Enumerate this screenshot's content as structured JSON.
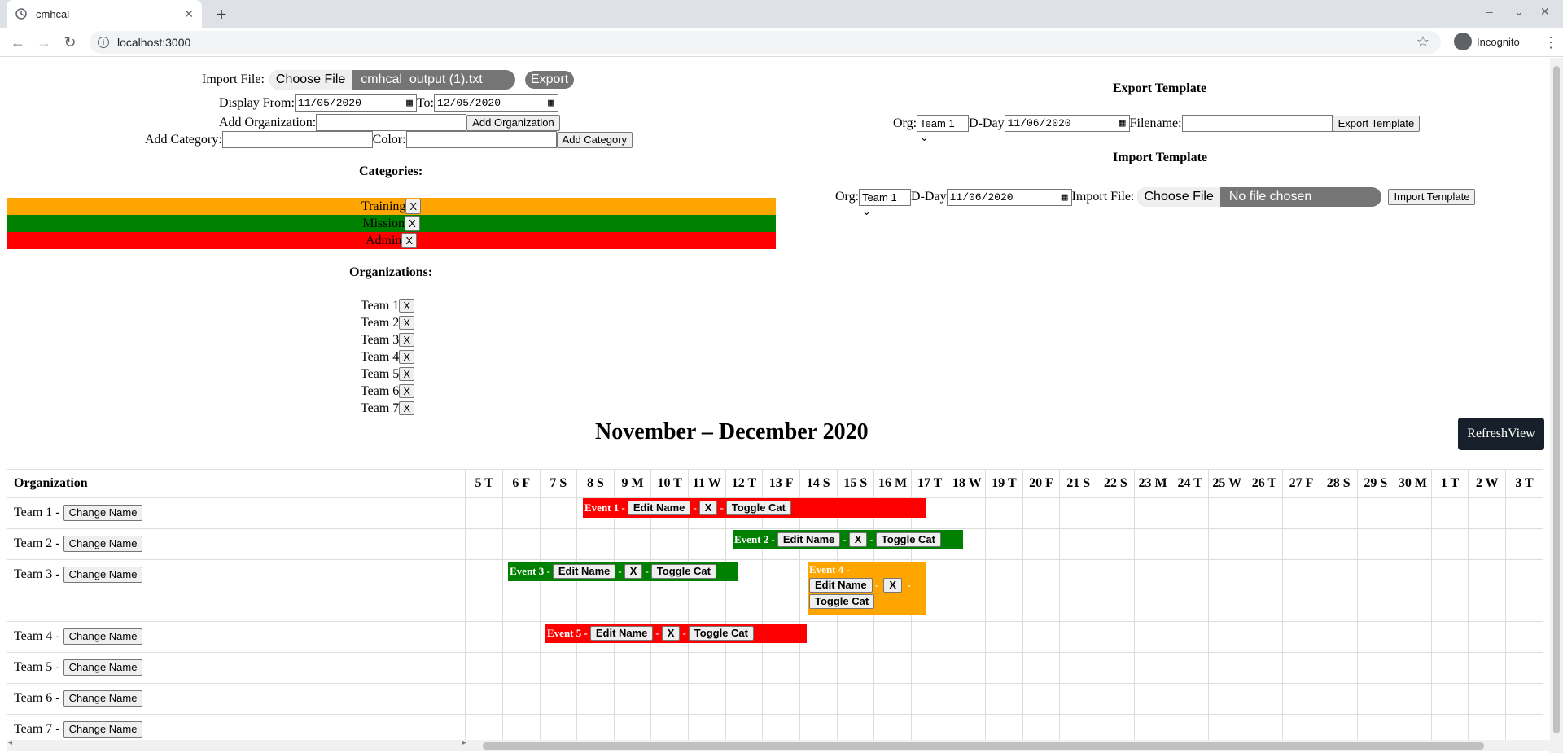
{
  "browser": {
    "tab_title": "cmhcal",
    "url": "localhost:3000",
    "profile": "Incognito"
  },
  "form": {
    "import_file_label": "Import File:",
    "choose_file": "Choose File",
    "import_file_value": "cmhcal_output (1).txt",
    "export_label": "Export",
    "display_from_label": "Display From:",
    "display_from_value": "11/05/2020",
    "to_label": "To:",
    "to_value": "12/05/2020",
    "add_org_label": "Add Organization:",
    "add_org_button": "Add Organization",
    "add_category_label": "Add Category:",
    "color_label": "Color:",
    "add_category_button": "Add Category"
  },
  "categories": {
    "heading": "Categories:",
    "items": [
      {
        "name": "Training",
        "color": "#ffa500"
      },
      {
        "name": "Mission",
        "color": "#008000"
      },
      {
        "name": "Admin",
        "color": "#ff0000"
      }
    ],
    "remove_label": "X"
  },
  "organizations": {
    "heading": "Organizations:",
    "items": [
      "Team 1",
      "Team 2",
      "Team 3",
      "Team 4",
      "Team 5",
      "Team 6",
      "Team 7"
    ],
    "remove_label": "X"
  },
  "export_template": {
    "heading": "Export Template",
    "org_label": "Org:",
    "org_value": "Team 1",
    "dday_label": "D-Day",
    "dday_value": "11/06/2020",
    "filename_label": "Filename:",
    "button": "Export Template"
  },
  "import_template": {
    "heading": "Import Template",
    "org_label": "Org:",
    "org_value": "Team 1",
    "dday_label": "D-Day",
    "dday_value": "11/06/2020",
    "file_label": "Import File:",
    "choose_file": "Choose File",
    "file_value": "No file chosen",
    "button": "Import Template"
  },
  "calendar": {
    "title": "November – December 2020",
    "refresh_label": "RefreshView",
    "org_header": "Organization",
    "days": [
      "5 T",
      "6 F",
      "7 S",
      "8 S",
      "9 M",
      "10 T",
      "11 W",
      "12 T",
      "13 F",
      "14 S",
      "15 S",
      "16 M",
      "17 T",
      "18 W",
      "19 T",
      "20 F",
      "21 S",
      "22 S",
      "23 M",
      "24 T",
      "25 W",
      "26 T",
      "27 F",
      "28 S",
      "29 S",
      "30 M",
      "1 T",
      "2 W",
      "3 T"
    ],
    "rows": [
      {
        "team": "Team 1 -",
        "button": "Change Name"
      },
      {
        "team": "Team 2 -",
        "button": "Change Name"
      },
      {
        "team": "Team 3 -",
        "button": "Change Name"
      },
      {
        "team": "Team 4 -",
        "button": "Change Name"
      },
      {
        "team": "Team 5 -",
        "button": "Change Name"
      },
      {
        "team": "Team 6 -",
        "button": "Change Name"
      },
      {
        "team": "Team 7 -",
        "button": "Change Name"
      }
    ],
    "events": [
      {
        "label": "Event 1 -",
        "color": "#ff0000",
        "edit": "Edit Name",
        "x": "X",
        "toggle": "Toggle Cat",
        "sep": "-"
      },
      {
        "label": "Event 2 -",
        "color": "#008000",
        "edit": "Edit Name",
        "x": "X",
        "toggle": "Toggle Cat",
        "sep": "-"
      },
      {
        "label": "Event 3 -",
        "color": "#008000",
        "edit": "Edit Name",
        "x": "X",
        "toggle": "Toggle Cat",
        "sep": "-"
      },
      {
        "label": "Event 4 -",
        "color": "#ffa500",
        "edit": "Edit Name",
        "x": "X",
        "toggle": "Toggle Cat",
        "sep": "-"
      },
      {
        "label": "Event 5 -",
        "color": "#ff0000",
        "edit": "Edit Name",
        "x": "X",
        "toggle": "Toggle Cat",
        "sep": "-"
      }
    ]
  }
}
